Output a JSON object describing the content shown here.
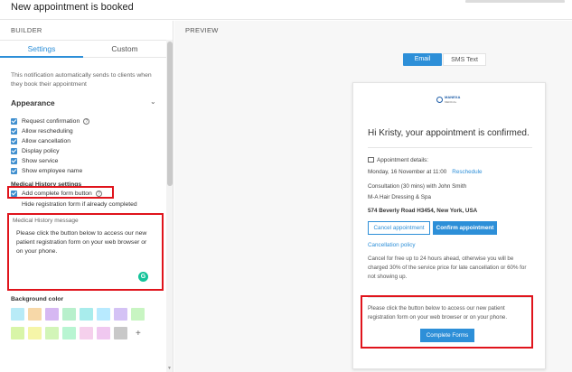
{
  "window": {
    "title": "New appointment is booked"
  },
  "builder": {
    "section_label": "BUILDER",
    "tabs": [
      {
        "label": "Settings",
        "active": true
      },
      {
        "label": "Custom",
        "active": false
      }
    ],
    "intro": "This notification automatically sends to clients when they book their appointment",
    "appearance": {
      "title": "Appearance",
      "options": [
        {
          "label": "Request confirmation",
          "checked": true,
          "help": true
        },
        {
          "label": "Allow rescheduling",
          "checked": true
        },
        {
          "label": "Allow cancellation",
          "checked": true
        },
        {
          "label": "Display policy",
          "checked": true
        },
        {
          "label": "Show service",
          "checked": true
        },
        {
          "label": "Show employee name",
          "checked": true
        }
      ]
    },
    "medical_history": {
      "title": "Medical History settings",
      "add_form_button": {
        "label": "Add complete form button",
        "checked": true
      },
      "hide_registration": "Hide registration form if already completed",
      "message_label": "Medical History message",
      "message_text": "Please click the button below to access our new patient registration form on your web browser or on your phone."
    },
    "background": {
      "label": "Background color",
      "swatches": [
        "#b8ebf7",
        "#f7d8a8",
        "#d6b8f2",
        "#b8f0cc",
        "#a8ecec",
        "#b8eaff",
        "#d4c2f5",
        "#c8f5c2",
        "#d8f5a8",
        "#f5f5a8",
        "#d2f5b8",
        "#b8f5d2",
        "#f5d0ec",
        "#f0c8f0",
        "#c8c8c8"
      ]
    }
  },
  "preview": {
    "section_label": "PREVIEW",
    "channels": [
      {
        "label": "Email",
        "active": true
      },
      {
        "label": "SMS Text",
        "active": false
      }
    ],
    "email": {
      "logo_line1": "MANEXA",
      "logo_line2": "MEDICAL",
      "greeting": "Hi Kristy, your appointment is confirmed.",
      "details_label": "Appointment details:",
      "datetime": "Monday, 16 November at 11:00",
      "reschedule": "Reschedule",
      "service": "Consultation (30 mins) with John Smith",
      "business": "M-A Hair Dressing & Spa",
      "address": "574 Beverly Road H3454, New York, USA",
      "cancel_button": "Cancel appointment",
      "confirm_button": "Confirm appointment",
      "policy_link": "Cancellation policy",
      "policy_text": "Cancel for free up to 24 hours ahead, otherwise you will be charged 30% of the service price for late cancellation or 60% for not showing up.",
      "form_text": "Please click the button below to access our new patient registration form on your web browser or on your phone.",
      "form_button": "Complete Forms"
    }
  },
  "colors": {
    "accent": "#2d8fd8",
    "highlight": "#e0141c"
  }
}
